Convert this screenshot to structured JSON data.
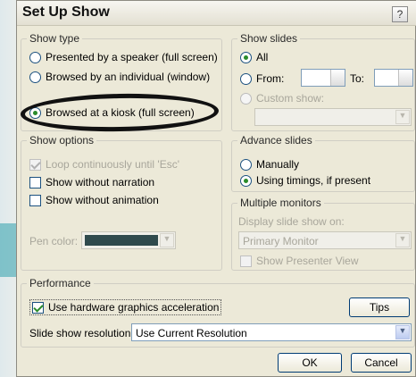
{
  "dialog": {
    "title": "Set Up Show",
    "help_label": "?"
  },
  "show_type": {
    "legend": "Show type",
    "options": [
      {
        "label": "Presented by a speaker (full screen)",
        "selected": false
      },
      {
        "label": "Browsed by an individual (window)",
        "selected": false
      },
      {
        "label": "Browsed at a kiosk (full screen)",
        "selected": true
      }
    ]
  },
  "show_slides": {
    "legend": "Show slides",
    "all_label": "All",
    "from_label": "From:",
    "to_label": "To:",
    "from_value": "",
    "to_value": "",
    "custom_label": "Custom show:",
    "custom_value": ""
  },
  "show_options": {
    "legend": "Show options",
    "loop_label": "Loop continuously until 'Esc'",
    "narration_label": "Show without narration",
    "animation_label": "Show without animation",
    "pen_color_label": "Pen color:",
    "pen_color": "#2f4a4d"
  },
  "advance_slides": {
    "legend": "Advance slides",
    "manual_label": "Manually",
    "timings_label": "Using timings, if present"
  },
  "monitors": {
    "legend": "Multiple monitors",
    "display_label": "Display slide show on:",
    "display_value": "Primary Monitor",
    "presenter_label": "Show Presenter View"
  },
  "performance": {
    "legend": "Performance",
    "hw_label": "Use hardware graphics acceleration",
    "tips_label": "Tips",
    "resolution_label": "Slide show resolution:",
    "resolution_value": "Use Current Resolution"
  },
  "buttons": {
    "ok": "OK",
    "cancel": "Cancel"
  },
  "colors": {
    "accent": "#2fa0ad",
    "dialog_bg": "#ece9d8",
    "annotation": "#111111"
  }
}
